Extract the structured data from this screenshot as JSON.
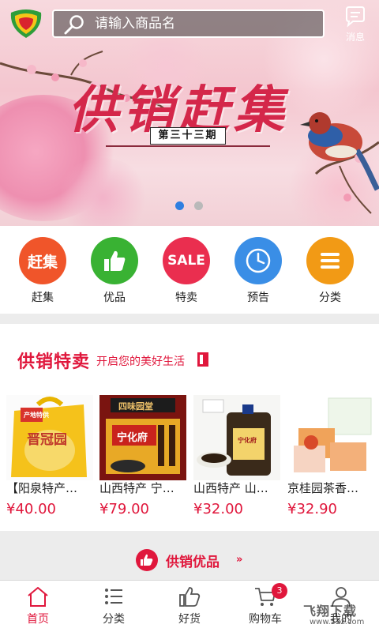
{
  "header": {
    "search_placeholder": "请输入商品名",
    "message_label": "消息"
  },
  "banner": {
    "title": "供销赶集",
    "issue": "第三十三期",
    "slide_count": 2,
    "active_slide": 1
  },
  "categories": [
    {
      "label": "赶集",
      "badge_text": "赶集",
      "color": "#f0552a",
      "icon": "text-badge"
    },
    {
      "label": "优品",
      "color": "#39b233",
      "icon": "thumbs-up-icon"
    },
    {
      "label": "特卖",
      "badge_text": "SALE",
      "color": "#ea2e4f",
      "icon": "text-badge"
    },
    {
      "label": "预告",
      "color": "#3a8ee6",
      "icon": "clock-icon"
    },
    {
      "label": "分类",
      "color": "#f29a15",
      "icon": "menu-icon"
    }
  ],
  "special": {
    "title": "供销特卖",
    "subtitle": "开启您的美好生活",
    "products": [
      {
        "name": "【阳泉特产…",
        "price": "¥40.00"
      },
      {
        "name": "山西特产 宁…",
        "price": "¥79.00"
      },
      {
        "name": "山西特产 山…",
        "price": "¥32.00"
      },
      {
        "name": "京桂园茶香…",
        "price": "¥32.90"
      }
    ]
  },
  "product_images": {
    "p1_bag_text": "晋冠园",
    "p1_tag_text": "产地特供",
    "p2_box_text": "宁化府",
    "p2_sign_text": "四味园堂",
    "p3_label_text": "宁化府"
  },
  "premium": {
    "label": "供销优品",
    "arrow": "»"
  },
  "bottom_nav": [
    {
      "label": "首页",
      "icon": "home-icon",
      "active": true
    },
    {
      "label": "分类",
      "icon": "list-icon"
    },
    {
      "label": "好货",
      "icon": "thumbs-up-icon"
    },
    {
      "label": "购物车",
      "icon": "cart-icon",
      "badge": "3"
    },
    {
      "label": "我的",
      "icon": "user-icon"
    }
  ],
  "watermark": {
    "text": "飞翔下载",
    "url": "www.52z.com"
  },
  "colors": {
    "accent": "#e0173c",
    "dot_active": "#2f7fe0"
  }
}
